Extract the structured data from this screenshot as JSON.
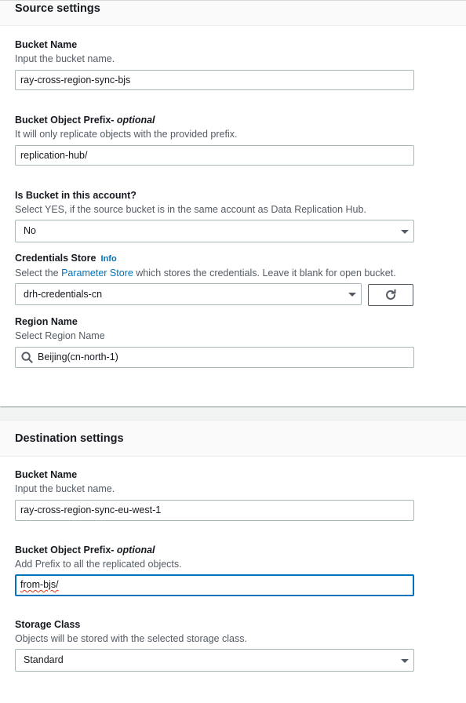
{
  "source": {
    "title": "Source settings",
    "bucket_name": {
      "label": "Bucket Name",
      "desc": "Input the bucket name.",
      "value": "ray-cross-region-sync-bjs"
    },
    "bucket_prefix": {
      "label": "Bucket Object Prefix- ",
      "optional": "optional",
      "desc": "It will only replicate objects with the provided prefix.",
      "value": "replication-hub/"
    },
    "in_account": {
      "label": "Is Bucket in this account?",
      "desc": "Select YES, if the source bucket is in the same account as Data Replication Hub.",
      "value": "No"
    },
    "credentials": {
      "label": "Credentials Store",
      "info": "Info",
      "desc_before": "Select the ",
      "desc_link": "Parameter Store",
      "desc_after": " which stores the credentials. Leave it blank for open bucket.",
      "value": "drh-credentials-cn",
      "refresh_icon": "refresh-icon"
    },
    "region": {
      "label": "Region Name",
      "desc": "Select Region Name",
      "value": "Beijing(cn-north-1)",
      "search_icon": "search-icon"
    }
  },
  "destination": {
    "title": "Destination settings",
    "bucket_name": {
      "label": "Bucket Name",
      "desc": "Input the bucket name.",
      "value": "ray-cross-region-sync-eu-west-1"
    },
    "bucket_prefix": {
      "label": "Bucket Object Prefix- ",
      "optional": "optional",
      "desc": "Add Prefix to all the replicated objects.",
      "value": "from-bjs/"
    },
    "storage_class": {
      "label": "Storage Class",
      "desc": "Objects will be stored with the selected storage class.",
      "value": "Standard"
    }
  },
  "colors": {
    "link": "#0073bb",
    "focus_border": "#0073bb",
    "border": "#aab7b8",
    "text_secondary": "#545b64"
  }
}
